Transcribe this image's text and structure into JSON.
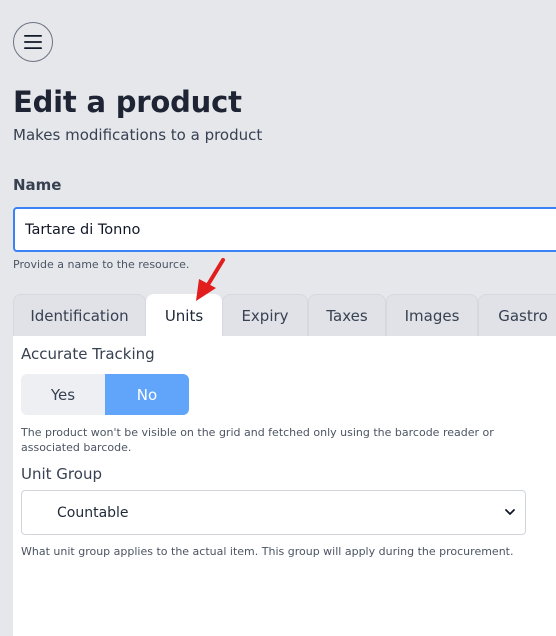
{
  "header": {
    "title": "Edit a product",
    "subtitle": "Makes modifications to a product"
  },
  "name_field": {
    "label": "Name",
    "value": "Tartare di Tonno",
    "help": "Provide a name to the resource."
  },
  "tabs": [
    {
      "label": "Identification",
      "active": false
    },
    {
      "label": "Units",
      "active": true
    },
    {
      "label": "Expiry",
      "active": false
    },
    {
      "label": "Taxes",
      "active": false
    },
    {
      "label": "Images",
      "active": false
    },
    {
      "label": "Gastro",
      "active": false
    }
  ],
  "units_tab": {
    "accurate_tracking": {
      "label": "Accurate Tracking",
      "options": [
        "Yes",
        "No"
      ],
      "selected": "No",
      "help": "The product won't be visible on the grid and fetched only using the barcode reader or associated barcode."
    },
    "unit_group": {
      "label": "Unit Group",
      "value": "Countable",
      "help": "What unit group applies to the actual item. This group will apply during the procurement."
    }
  },
  "colors": {
    "accent": "#60a5fa",
    "input_focus": "#3b82f6",
    "annotation_arrow": "#e11d1d"
  }
}
